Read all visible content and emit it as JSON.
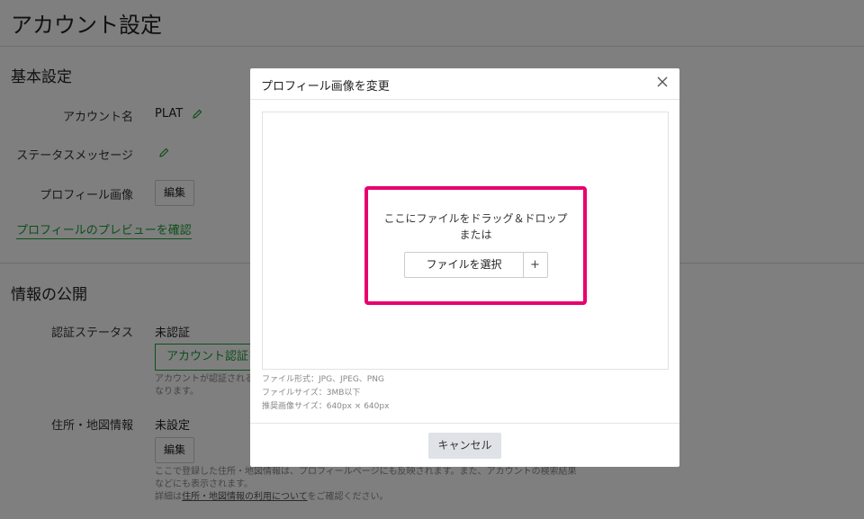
{
  "page": {
    "title": "アカウント設定",
    "basic_section": {
      "title": "基本設定",
      "account_name_label": "アカウント名",
      "account_name_value": "PLAT",
      "status_message_label": "ステータスメッセージ",
      "profile_image_label": "プロフィール画像",
      "edit_button": "編集",
      "preview_link": "プロフィールのプレビューを確認"
    },
    "public_section": {
      "title": "情報の公開",
      "auth_status_label": "認証ステータス",
      "auth_status_value": "未認証",
      "auth_button": "アカウント認証を",
      "auth_note_line1": "アカウントが認証される",
      "auth_note_line2": "なります。",
      "address_label": "住所・地図情報",
      "address_value": "未設定",
      "address_edit_button": "編集",
      "address_note_line1": "ここで登録した住所・地図情報は、プロフィールページにも反映されます。また、アカウントの検索結果",
      "address_note_line2": "などにも表示されます。",
      "address_note_line3_prefix": "詳細は",
      "address_note_line3_link": "住所・地図情報の利用について",
      "address_note_line3_suffix": "をご確認ください。"
    }
  },
  "modal": {
    "title": "プロフィール画像を変更",
    "drop_text_line1": "ここにファイルをドラッグ＆ドロップ",
    "drop_text_line2": "または",
    "file_select_label": "ファイルを選択",
    "file_select_plus": "+",
    "file_format": "ファイル形式：JPG、JPEG、PNG",
    "file_size": "ファイルサイズ：3MB以下",
    "recommended_size": "推奨画像サイズ：640px × 640px",
    "cancel_button": "キャンセル"
  },
  "colors": {
    "accent_green": "#1a9e34",
    "highlight_pink": "#e8006e",
    "overlay": "rgba(0,0,0,0.5)"
  },
  "icons": {
    "pencil": "pencil-icon",
    "close": "close-icon"
  }
}
